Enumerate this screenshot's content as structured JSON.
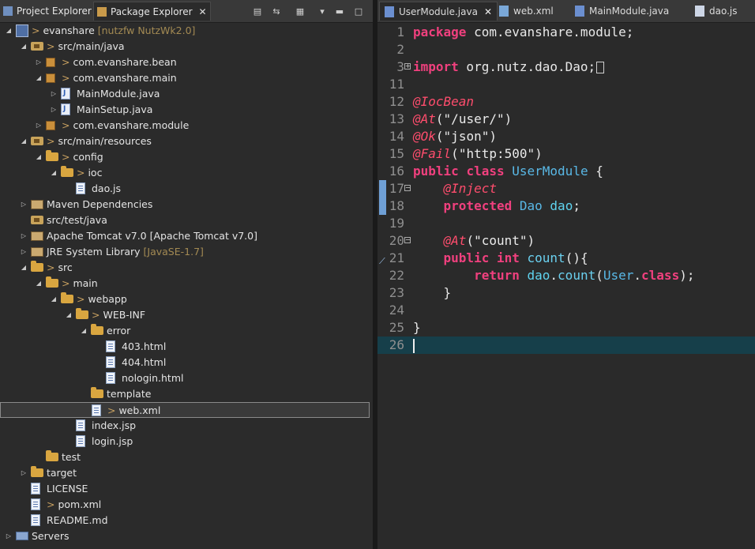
{
  "left_tabs": [
    {
      "label": "Project Explorer",
      "icon": "project-explorer-icon",
      "active": false
    },
    {
      "label": "Package Explorer",
      "icon": "package-explorer-icon",
      "active": true,
      "close": "✕"
    }
  ],
  "left_toolbar": [
    "collapse-all-icon",
    "link-editor-icon",
    "focus-icon",
    "view-menu-icon",
    "minimize-icon",
    "maximize-icon"
  ],
  "tree": [
    {
      "depth": 0,
      "twisty": "open",
      "icon": "project",
      "prefix": "> ",
      "label": "evanshare",
      "deco": " [nutzfw NutzWk2.0]"
    },
    {
      "depth": 1,
      "twisty": "open",
      "icon": "srcfolder",
      "prefix": "> ",
      "label": "src/main/java",
      "deco": ""
    },
    {
      "depth": 2,
      "twisty": "closed",
      "icon": "pkg",
      "prefix": "> ",
      "label": "com.evanshare.bean",
      "deco": ""
    },
    {
      "depth": 2,
      "twisty": "open",
      "icon": "pkg",
      "prefix": "> ",
      "label": "com.evanshare.main",
      "deco": ""
    },
    {
      "depth": 3,
      "twisty": "closed",
      "icon": "java",
      "prefix": "",
      "label": "MainModule.java",
      "deco": ""
    },
    {
      "depth": 3,
      "twisty": "closed",
      "icon": "java",
      "prefix": "",
      "label": "MainSetup.java",
      "deco": ""
    },
    {
      "depth": 2,
      "twisty": "closed",
      "icon": "pkg",
      "prefix": "> ",
      "label": "com.evanshare.module",
      "deco": ""
    },
    {
      "depth": 1,
      "twisty": "open",
      "icon": "srcfolder",
      "prefix": "> ",
      "label": "src/main/resources",
      "deco": ""
    },
    {
      "depth": 2,
      "twisty": "open",
      "icon": "folder",
      "prefix": "> ",
      "label": "config",
      "deco": ""
    },
    {
      "depth": 3,
      "twisty": "open",
      "icon": "folder",
      "prefix": "> ",
      "label": "ioc",
      "deco": ""
    },
    {
      "depth": 4,
      "twisty": "none",
      "icon": "file",
      "prefix": "",
      "label": "dao.js",
      "deco": ""
    },
    {
      "depth": 1,
      "twisty": "closed",
      "icon": "lib",
      "prefix": "",
      "label": "Maven Dependencies",
      "deco": ""
    },
    {
      "depth": 1,
      "twisty": "none",
      "icon": "srcfolder",
      "prefix": "",
      "label": "src/test/java",
      "deco": ""
    },
    {
      "depth": 1,
      "twisty": "closed",
      "icon": "lib",
      "prefix": "",
      "label": "Apache Tomcat v7.0 [Apache Tomcat v7.0]",
      "deco": ""
    },
    {
      "depth": 1,
      "twisty": "closed",
      "icon": "lib",
      "prefix": "",
      "label": "JRE System Library",
      "deco": " [JavaSE-1.7]"
    },
    {
      "depth": 1,
      "twisty": "open",
      "icon": "folder",
      "prefix": "> ",
      "label": "src",
      "deco": ""
    },
    {
      "depth": 2,
      "twisty": "open",
      "icon": "folder",
      "prefix": "> ",
      "label": "main",
      "deco": ""
    },
    {
      "depth": 3,
      "twisty": "open",
      "icon": "folder",
      "prefix": "> ",
      "label": "webapp",
      "deco": ""
    },
    {
      "depth": 4,
      "twisty": "open",
      "icon": "folder",
      "prefix": "> ",
      "label": "WEB-INF",
      "deco": ""
    },
    {
      "depth": 5,
      "twisty": "open",
      "icon": "folder",
      "prefix": "",
      "label": "error",
      "deco": ""
    },
    {
      "depth": 6,
      "twisty": "none",
      "icon": "file",
      "prefix": "",
      "label": "403.html",
      "deco": ""
    },
    {
      "depth": 6,
      "twisty": "none",
      "icon": "file",
      "prefix": "",
      "label": "404.html",
      "deco": ""
    },
    {
      "depth": 6,
      "twisty": "none",
      "icon": "file",
      "prefix": "",
      "label": "nologin.html",
      "deco": ""
    },
    {
      "depth": 5,
      "twisty": "none",
      "icon": "folder",
      "prefix": "",
      "label": "template",
      "deco": ""
    },
    {
      "depth": 5,
      "twisty": "none",
      "icon": "file",
      "prefix": "> ",
      "label": "web.xml",
      "deco": "",
      "selected": true
    },
    {
      "depth": 4,
      "twisty": "none",
      "icon": "file",
      "prefix": "",
      "label": "index.jsp",
      "deco": ""
    },
    {
      "depth": 4,
      "twisty": "none",
      "icon": "file",
      "prefix": "",
      "label": "login.jsp",
      "deco": ""
    },
    {
      "depth": 2,
      "twisty": "none",
      "icon": "folder",
      "prefix": "",
      "label": "test",
      "deco": ""
    },
    {
      "depth": 1,
      "twisty": "closed",
      "icon": "folder",
      "prefix": "",
      "label": "target",
      "deco": ""
    },
    {
      "depth": 1,
      "twisty": "none",
      "icon": "file",
      "prefix": "",
      "label": "LICENSE",
      "deco": ""
    },
    {
      "depth": 1,
      "twisty": "none",
      "icon": "file",
      "prefix": "> ",
      "label": "pom.xml",
      "deco": ""
    },
    {
      "depth": 1,
      "twisty": "none",
      "icon": "file",
      "prefix": "",
      "label": "README.md",
      "deco": ""
    },
    {
      "depth": 0,
      "twisty": "closed",
      "icon": "server",
      "prefix": "",
      "label": "Servers",
      "deco": ""
    }
  ],
  "editor_tabs": [
    {
      "label": "UserModule.java",
      "icon": "java-file-icon",
      "active": true,
      "close": "✕"
    },
    {
      "label": "web.xml",
      "icon": "xml-file-icon",
      "active": false
    },
    {
      "label": "MainModule.java",
      "icon": "java-file-icon",
      "active": false
    },
    {
      "label": "dao.js",
      "icon": "js-file-icon",
      "active": false
    }
  ],
  "code_lines": [
    {
      "n": "1",
      "tokens": [
        [
          "kw",
          "package"
        ],
        [
          "pln",
          " com.evanshare.module;"
        ]
      ]
    },
    {
      "n": "2",
      "tokens": []
    },
    {
      "n": "3",
      "fold": "+",
      "tokens": [
        [
          "kw",
          "import"
        ],
        [
          "pln",
          " org.nutz.dao.Dao;"
        ],
        [
          "box",
          ""
        ]
      ]
    },
    {
      "n": "11",
      "tokens": []
    },
    {
      "n": "12",
      "tokens": [
        [
          "ann",
          "@IocBean"
        ]
      ]
    },
    {
      "n": "13",
      "tokens": [
        [
          "ann",
          "@At"
        ],
        [
          "pln",
          "("
        ],
        [
          "str",
          "\"/user/\""
        ],
        [
          "pln",
          ")"
        ]
      ]
    },
    {
      "n": "14",
      "tokens": [
        [
          "ann",
          "@Ok"
        ],
        [
          "pln",
          "("
        ],
        [
          "str",
          "\"json\""
        ],
        [
          "pln",
          ")"
        ]
      ]
    },
    {
      "n": "15",
      "tokens": [
        [
          "ann",
          "@Fail"
        ],
        [
          "pln",
          "("
        ],
        [
          "str",
          "\"http:500\""
        ],
        [
          "pln",
          ")"
        ]
      ]
    },
    {
      "n": "16",
      "tokens": [
        [
          "kw",
          "public"
        ],
        [
          "pln",
          " "
        ],
        [
          "kw",
          "class"
        ],
        [
          "pln",
          " "
        ],
        [
          "typ",
          "UserModule"
        ],
        [
          "pln",
          " {"
        ]
      ]
    },
    {
      "n": "17",
      "fold": "−",
      "mark": true,
      "tokens": [
        [
          "pln",
          "    "
        ],
        [
          "ann",
          "@Inject"
        ]
      ]
    },
    {
      "n": "18",
      "mark": true,
      "tokens": [
        [
          "pln",
          "    "
        ],
        [
          "kw",
          "protected"
        ],
        [
          "pln",
          " "
        ],
        [
          "typ",
          "Dao"
        ],
        [
          "pln",
          " "
        ],
        [
          "fld",
          "dao"
        ],
        [
          "pln",
          ";"
        ]
      ]
    },
    {
      "n": "19",
      "tokens": []
    },
    {
      "n": "20",
      "fold": "−",
      "tokens": [
        [
          "pln",
          "    "
        ],
        [
          "ann",
          "@At"
        ],
        [
          "pln",
          "("
        ],
        [
          "str",
          "\"count\""
        ],
        [
          "pln",
          ")"
        ]
      ]
    },
    {
      "n": "21",
      "override": true,
      "tokens": [
        [
          "pln",
          "    "
        ],
        [
          "kw",
          "public"
        ],
        [
          "pln",
          " "
        ],
        [
          "kw",
          "int"
        ],
        [
          "pln",
          " "
        ],
        [
          "mth",
          "count"
        ],
        [
          "pln",
          "(){"
        ]
      ]
    },
    {
      "n": "22",
      "tokens": [
        [
          "pln",
          "        "
        ],
        [
          "kw",
          "return"
        ],
        [
          "pln",
          " "
        ],
        [
          "fld",
          "dao"
        ],
        [
          "pln",
          "."
        ],
        [
          "mth",
          "count"
        ],
        [
          "pln",
          "("
        ],
        [
          "typ",
          "User"
        ],
        [
          "pln",
          "."
        ],
        [
          "kw",
          "class"
        ],
        [
          "pln",
          ");"
        ]
      ]
    },
    {
      "n": "23",
      "tokens": [
        [
          "pln",
          "    }"
        ]
      ]
    },
    {
      "n": "24",
      "tokens": []
    },
    {
      "n": "25",
      "tokens": [
        [
          "pln",
          "}"
        ]
      ]
    },
    {
      "n": "26",
      "current": true,
      "tokens": [
        [
          "cursor",
          ""
        ]
      ]
    }
  ]
}
